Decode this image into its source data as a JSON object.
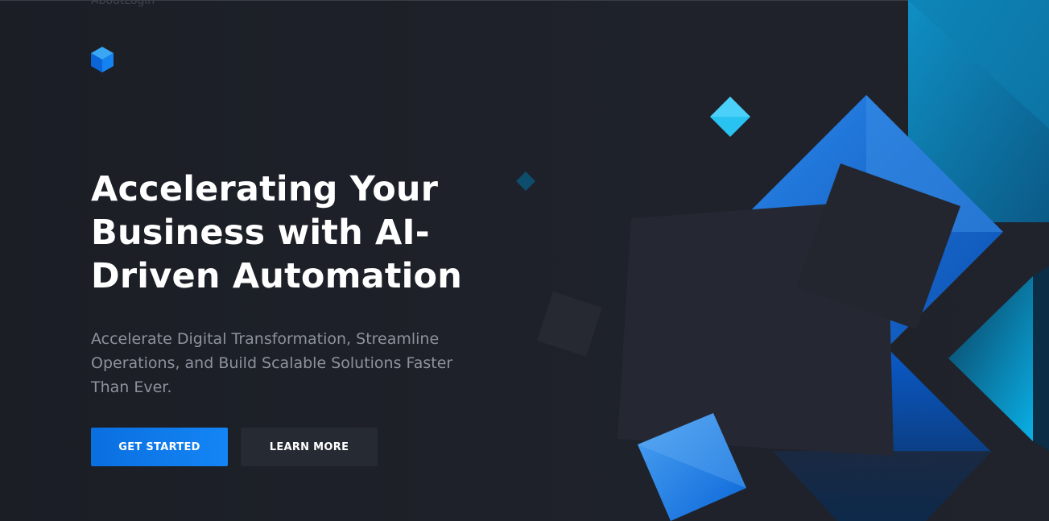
{
  "nav": {
    "about": "About",
    "login": "Login"
  },
  "hero": {
    "title": "Accelerating Your Business with AI-Driven Automation",
    "subtitle": "Accelerate Digital Transformation, Streamline Operations, and Build Scalable Solutions Faster Than Ever.",
    "primary_cta": "GET STARTED",
    "secondary_cta": "LEARN MORE"
  },
  "brand": {
    "logo_icon": "cube-icon",
    "accent": "#1485f5",
    "accent_dark": "#0a6fe0",
    "teal": "#0aa6d6",
    "background": "#1e2129"
  }
}
